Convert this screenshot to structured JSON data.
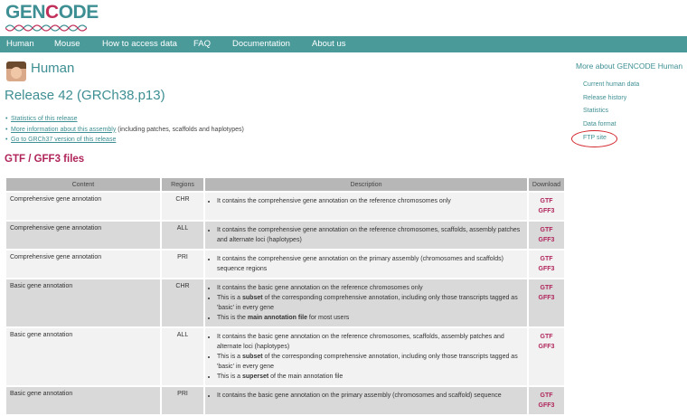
{
  "logo": {
    "text_pre": "GEN",
    "text_red": "C",
    "text_post": "ODE"
  },
  "nav": [
    "Human",
    "Mouse",
    "How to access data",
    "FAQ",
    "Documentation",
    "About us"
  ],
  "page_title": "Human",
  "release": "Release 42 (GRCh38.p13)",
  "links": [
    {
      "link": "Statistics of this release",
      "rest": ""
    },
    {
      "link": "More information about this assembly",
      "rest": " (including patches, scaffolds and haplotypes)"
    },
    {
      "link": "Go to GRCh37 version of this release",
      "rest": ""
    }
  ],
  "section_title": "GTF / GFF3 files",
  "table": {
    "headers": [
      "Content",
      "Regions",
      "Description",
      "Download"
    ],
    "rows": [
      {
        "content": "Comprehensive gene annotation",
        "region": "CHR",
        "dl": [
          "GTF",
          "GFF3"
        ],
        "desc": [
          [
            {
              "t": "It contains the comprehensive gene annotation on the reference chromosomes only"
            }
          ]
        ]
      },
      {
        "content": "Comprehensive gene annotation",
        "region": "ALL",
        "dl": [
          "GTF",
          "GFF3"
        ],
        "desc": [
          [
            {
              "t": "It contains the comprehensive gene annotation on the reference chromosomes, scaffolds, assembly patches and alternate loci (haplotypes)"
            }
          ]
        ]
      },
      {
        "content": "Comprehensive gene annotation",
        "region": "PRI",
        "dl": [
          "GTF",
          "GFF3"
        ],
        "desc": [
          [
            {
              "t": "It contains the comprehensive gene annotation on the primary assembly (chromosomes and scaffolds) sequence regions"
            }
          ]
        ]
      },
      {
        "content": "Basic gene annotation",
        "region": "CHR",
        "dl": [
          "GTF",
          "GFF3"
        ],
        "desc": [
          [
            {
              "t": "It contains the basic gene annotation on the reference chromosomes only"
            }
          ],
          [
            {
              "t": "This is a "
            },
            {
              "t": "subset",
              "b": true
            },
            {
              "t": " of the corresponding comprehensive annotation, including only those transcripts tagged as 'basic' in every gene"
            }
          ],
          [
            {
              "t": "This is the "
            },
            {
              "t": "main annotation file",
              "b": true
            },
            {
              "t": " for most users"
            }
          ]
        ]
      },
      {
        "content": "Basic gene annotation",
        "region": "ALL",
        "dl": [
          "GTF",
          "GFF3"
        ],
        "desc": [
          [
            {
              "t": "It contains the basic gene annotation on the reference chromosomes, scaffolds, assembly patches and alternate loci (haplotypes)"
            }
          ],
          [
            {
              "t": "This is a "
            },
            {
              "t": "subset",
              "b": true
            },
            {
              "t": " of the corresponding comprehensive annotation, including only those transcripts tagged as 'basic' in every gene"
            }
          ],
          [
            {
              "t": "This is a "
            },
            {
              "t": "superset",
              "b": true
            },
            {
              "t": " of the main annotation file"
            }
          ]
        ]
      },
      {
        "content": "Basic gene annotation",
        "region": "PRI",
        "dl": [
          "GTF",
          "GFF3"
        ],
        "desc": [
          [
            {
              "t": "It contains the basic gene annotation on the primary assembly (chromosomes and scaffold) sequence"
            }
          ]
        ]
      }
    ]
  },
  "sidebar": {
    "title": "More about GENCODE Human",
    "items": [
      "Current human data",
      "Release history",
      "Statistics",
      "Data format",
      "FTP site"
    ]
  },
  "colors": {
    "teal": "#3e8f93",
    "nav_bg": "#4a9a9a",
    "accent_red": "#b0245a",
    "highlight_circle": "#d2232a"
  }
}
